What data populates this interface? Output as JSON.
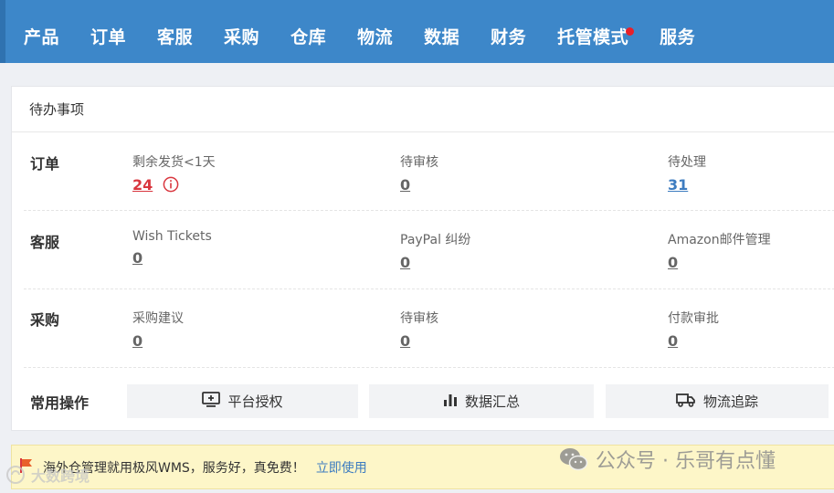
{
  "nav": {
    "items": [
      "产品",
      "订单",
      "客服",
      "采购",
      "仓库",
      "物流",
      "数据",
      "财务",
      "托管模式",
      "服务"
    ],
    "badge_color": "#e8202a",
    "bg_color": "#3d87c9"
  },
  "todo": {
    "title": "待办事项",
    "rows": [
      {
        "label": "订单",
        "cells": [
          {
            "label": "剩余发货<1天",
            "value": "24",
            "color": "#d9363e",
            "icon": "info-icon"
          },
          {
            "label": "待审核",
            "value": "0"
          },
          {
            "label": "待处理",
            "value": "31",
            "color": "#3d7cc0"
          }
        ]
      },
      {
        "label": "客服",
        "cells": [
          {
            "label": "Wish Tickets",
            "value": "0"
          },
          {
            "label": "PayPal 纠纷",
            "value": "0"
          },
          {
            "label": "Amazon邮件管理",
            "value": "0"
          }
        ]
      },
      {
        "label": "采购",
        "cells": [
          {
            "label": "采购建议",
            "value": "0"
          },
          {
            "label": "待审核",
            "value": "0"
          },
          {
            "label": "付款审批",
            "value": "0"
          }
        ]
      }
    ]
  },
  "ops": {
    "label": "常用操作",
    "buttons": [
      {
        "label": "平台授权",
        "icon": "monitor-plus-icon"
      },
      {
        "label": "数据汇总",
        "icon": "bar-chart-icon"
      },
      {
        "label": "物流追踪",
        "icon": "truck-icon"
      }
    ]
  },
  "banner": {
    "text": "海外仓管理就用极风WMS，服务好，真免费！",
    "link": "立即使用",
    "icon": "flag-icon"
  },
  "watermarks": {
    "right": "公众号 · 乐哥有点懂",
    "left": "大数跨境"
  }
}
